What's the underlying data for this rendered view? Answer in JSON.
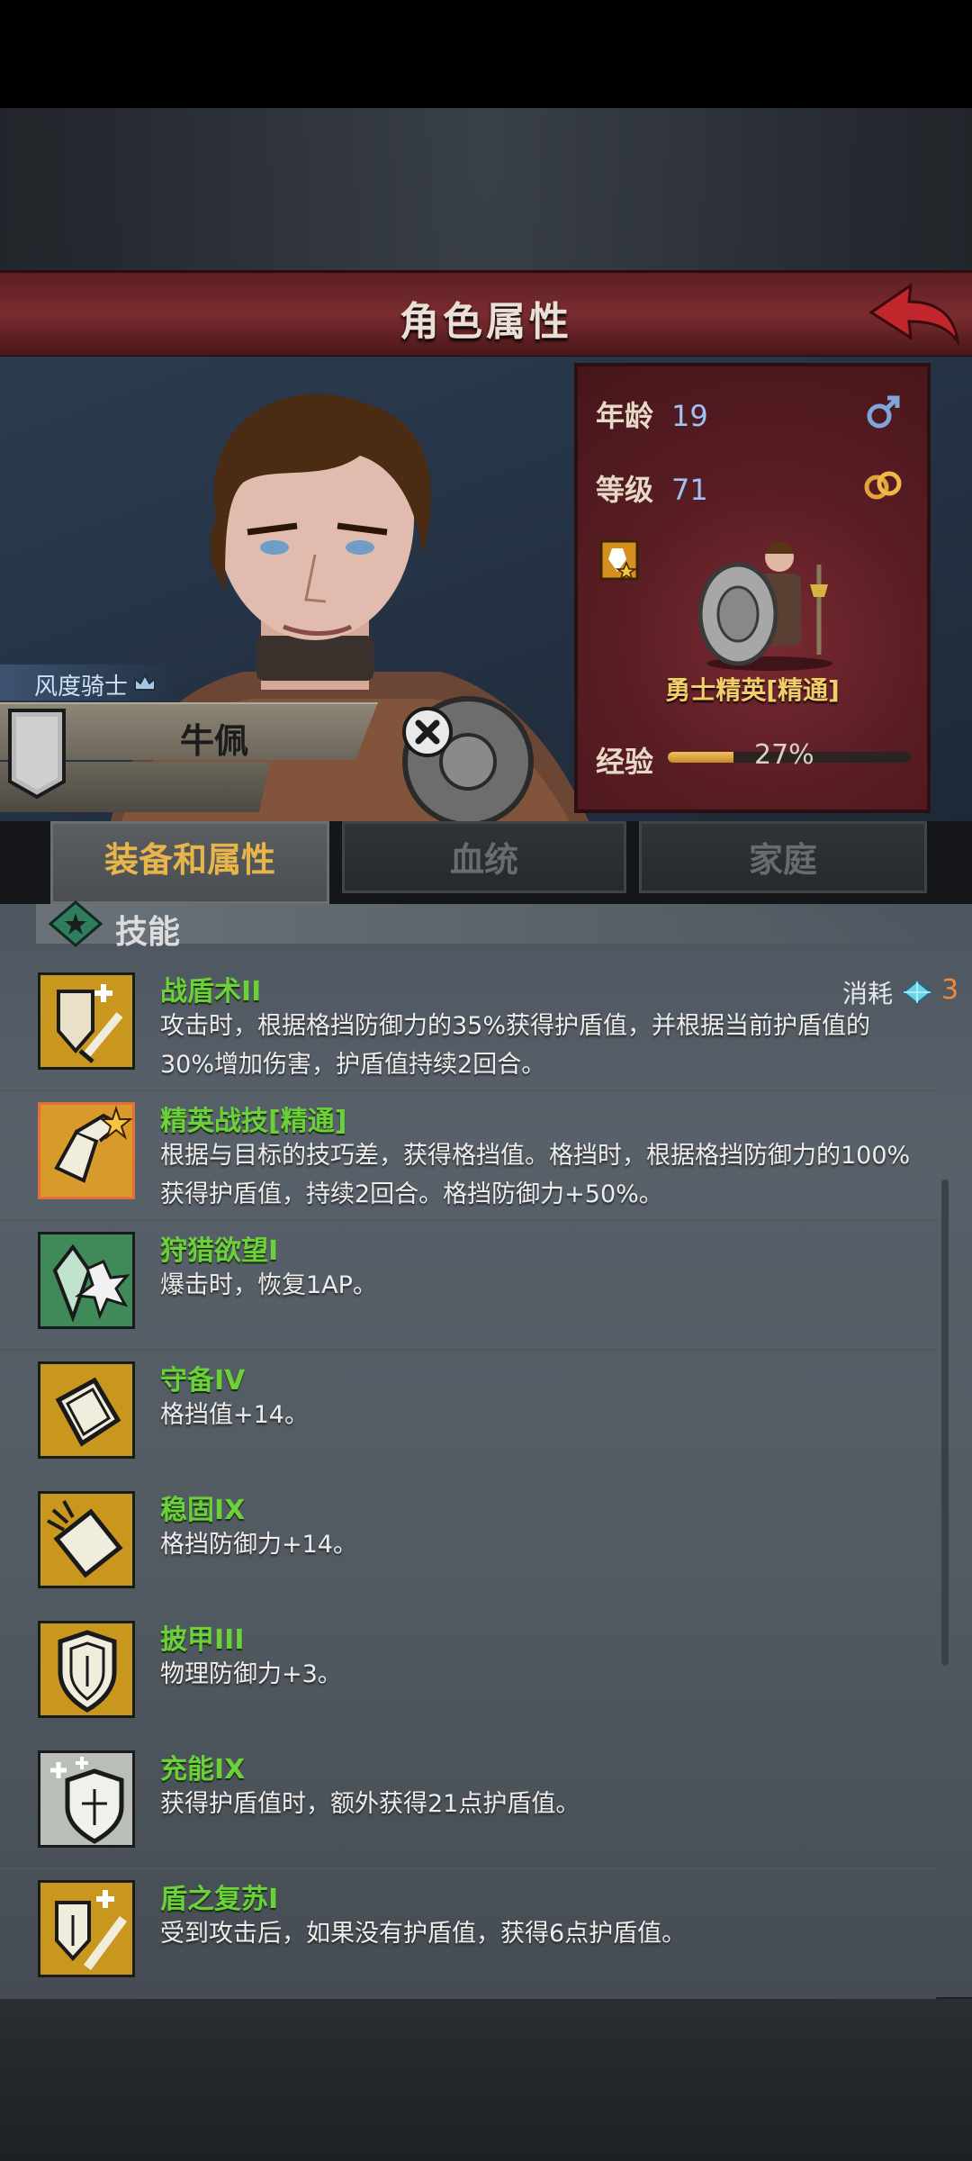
{
  "header": {
    "title": "角色属性"
  },
  "character": {
    "class_label": "风度骑士",
    "name": "牛佩"
  },
  "info": {
    "age_label": "年龄",
    "age": "19",
    "level_label": "等级",
    "level": "71",
    "rank_title": "勇士精英[精通]",
    "exp_label": "经验",
    "exp_percent": "27%",
    "exp_fraction": 0.27
  },
  "tabs": [
    {
      "label": "装备和属性",
      "active": true
    },
    {
      "label": "血统",
      "active": false
    },
    {
      "label": "家庭",
      "active": false
    }
  ],
  "skills_section": {
    "title": "技能",
    "cost_label": "消耗",
    "cost_value": "3",
    "items": [
      {
        "name": "战盾术II",
        "desc": "攻击时，根据格挡防御力的35%获得护盾值，并根据当前护盾值的30%增加伤害，护盾值持续2回合。",
        "icon": "shield-sword-icon",
        "color": "#c9961e"
      },
      {
        "name": "精英战技[精通]",
        "desc": "根据与目标的技巧差，获得格挡值。格挡时，根据格挡防御力的100%获得护盾值，持续2回合。格挡防御力+50%。",
        "icon": "elite-technique-icon",
        "color": "#d89a2a"
      },
      {
        "name": "狩猎欲望I",
        "desc": "爆击时，恢复1AP。",
        "icon": "hunting-crystal-icon",
        "color": "#3f8a58"
      },
      {
        "name": "守备IV",
        "desc": "格挡值+14。",
        "icon": "guard-block-icon",
        "color": "#c9961e"
      },
      {
        "name": "稳固IX",
        "desc": "格挡防御力+14。",
        "icon": "steady-block-icon",
        "color": "#c9961e"
      },
      {
        "name": "披甲III",
        "desc": "物理防御力+3。",
        "icon": "armor-shield-icon",
        "color": "#c9961e"
      },
      {
        "name": "充能IX",
        "desc": "获得护盾值时，额外获得21点护盾值。",
        "icon": "charge-shield-icon",
        "color": "#b9bfb6"
      },
      {
        "name": "盾之复苏I",
        "desc": "受到攻击后，如果没有护盾值，获得6点护盾值。",
        "icon": "shield-revive-icon",
        "color": "#c9961e"
      }
    ]
  }
}
